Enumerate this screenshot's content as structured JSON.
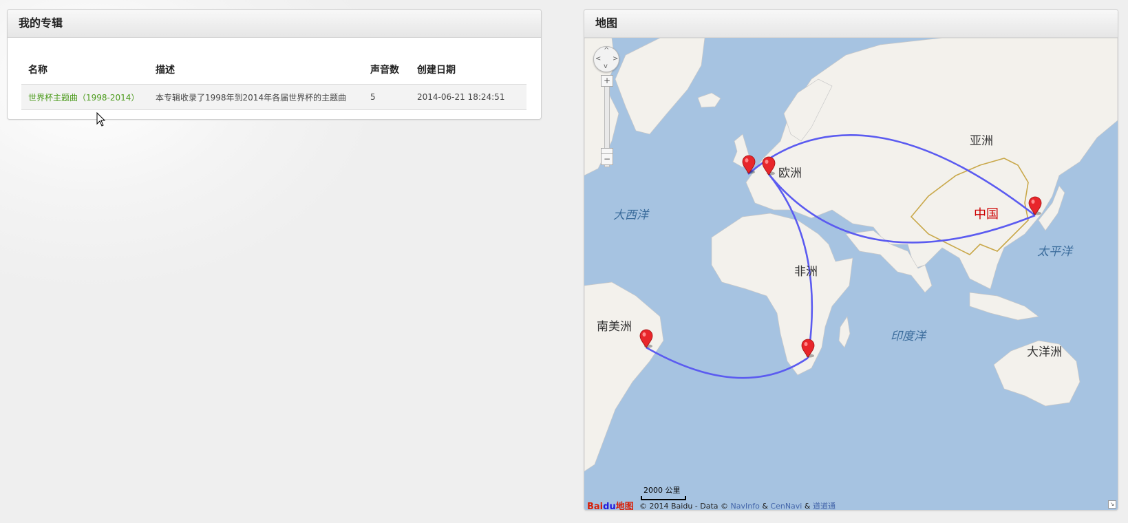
{
  "album_panel": {
    "title": "我的专辑",
    "columns": [
      "名称",
      "描述",
      "声音数",
      "创建日期"
    ],
    "rows": [
      {
        "name": "世界杯主题曲（1998-2014）",
        "description": "本专辑收录了1998年到2014年各届世界杯的主题曲",
        "count": "5",
        "created": "2014-06-21 18:24:51"
      }
    ]
  },
  "map_panel": {
    "title": "地图",
    "labels": {
      "asia": "亚洲",
      "europe": "欧洲",
      "africa": "非洲",
      "south_america": "南美洲",
      "oceania": "大洋洲",
      "china": "中国",
      "atlantic": "大西洋",
      "pacific": "太平洋",
      "indian": "印度洋"
    },
    "zoom_in": "+",
    "zoom_out": "−",
    "scale": "2000 公里",
    "logo": {
      "text1": "Bai",
      "paw": "du",
      "text2": "地图"
    },
    "copyright": {
      "prefix": "© 2014 Baidu - Data ©",
      "navinfo": "NavInfo",
      "amp1": "&",
      "cennavi": "CenNavi",
      "amp2": "&",
      "daodaotong": "道道通"
    },
    "marker_color": "#e8262b",
    "route_color": "#5b5bf0",
    "sea_color": "#a6c3e1",
    "land_color": "#f3f1ec"
  }
}
